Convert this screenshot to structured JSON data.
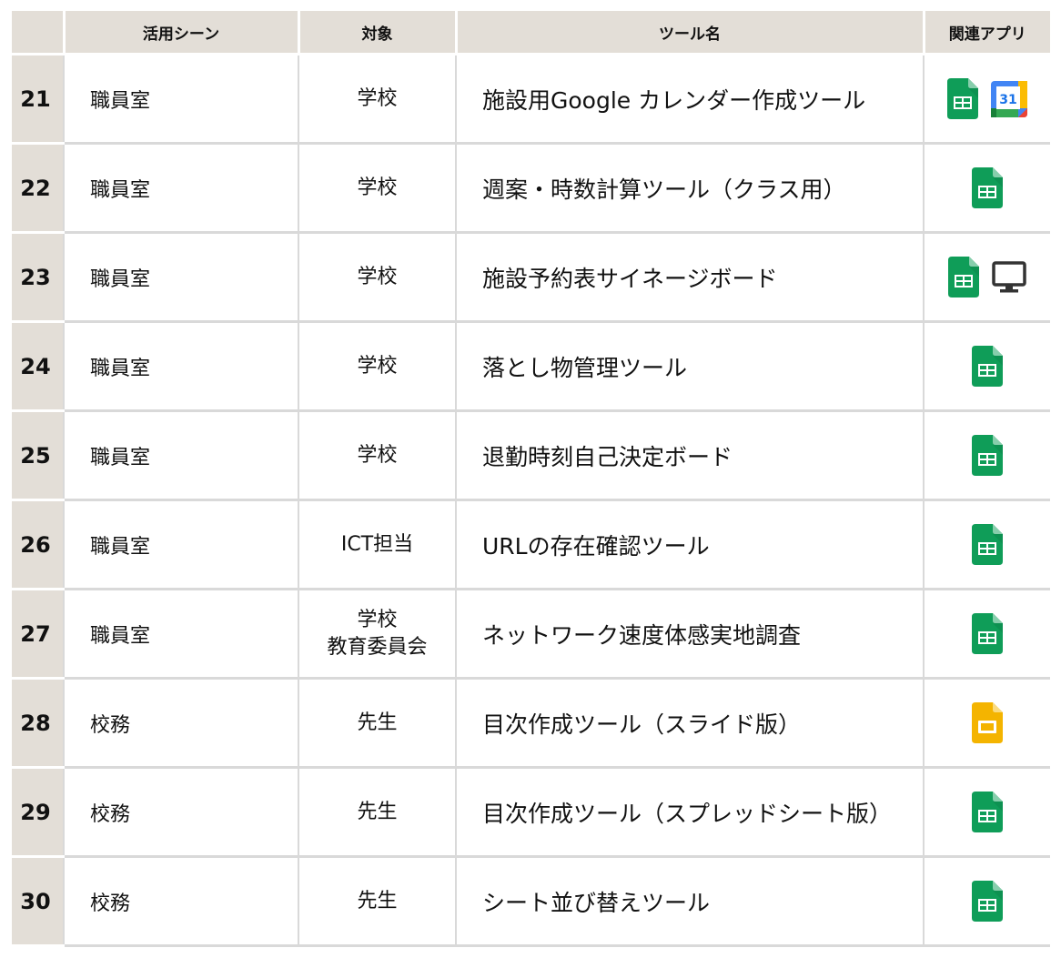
{
  "headers": {
    "num": "",
    "scene": "活用シーン",
    "target": "対象",
    "tool": "ツール名",
    "apps": "関連アプリ"
  },
  "rows": [
    {
      "num": "21",
      "scene": "職員室",
      "target": [
        "学校"
      ],
      "tool": "施設用Google カレンダー作成ツール",
      "apps": [
        "sheets-icon",
        "calendar-icon"
      ]
    },
    {
      "num": "22",
      "scene": "職員室",
      "target": [
        "学校"
      ],
      "tool": "週案・時数計算ツール（クラス用）",
      "apps": [
        "sheets-icon"
      ]
    },
    {
      "num": "23",
      "scene": "職員室",
      "target": [
        "学校"
      ],
      "tool": "施設予約表サイネージボード",
      "apps": [
        "sheets-icon",
        "monitor-icon"
      ]
    },
    {
      "num": "24",
      "scene": "職員室",
      "target": [
        "学校"
      ],
      "tool": "落とし物管理ツール",
      "apps": [
        "sheets-icon"
      ]
    },
    {
      "num": "25",
      "scene": "職員室",
      "target": [
        "学校"
      ],
      "tool": "退勤時刻自己決定ボード",
      "apps": [
        "sheets-icon"
      ]
    },
    {
      "num": "26",
      "scene": "職員室",
      "target": [
        "ICT担当"
      ],
      "tool": "URLの存在確認ツール",
      "apps": [
        "sheets-icon"
      ]
    },
    {
      "num": "27",
      "scene": "職員室",
      "target": [
        "学校",
        "教育委員会"
      ],
      "tool": "ネットワーク速度体感実地調査",
      "apps": [
        "sheets-icon"
      ]
    },
    {
      "num": "28",
      "scene": "校務",
      "target": [
        "先生"
      ],
      "tool": "目次作成ツール（スライド版）",
      "apps": [
        "slides-icon"
      ]
    },
    {
      "num": "29",
      "scene": "校務",
      "target": [
        "先生"
      ],
      "tool": "目次作成ツール（スプレッドシート版）",
      "apps": [
        "sheets-icon"
      ]
    },
    {
      "num": "30",
      "scene": "校務",
      "target": [
        "先生"
      ],
      "tool": "シート並び替えツール",
      "apps": [
        "sheets-icon"
      ]
    }
  ],
  "colors": {
    "header_bg": "#e3ded7",
    "sheets_green": "#0f9d58",
    "slides_yellow": "#f4b400",
    "grid_line": "#d9d9d9"
  }
}
